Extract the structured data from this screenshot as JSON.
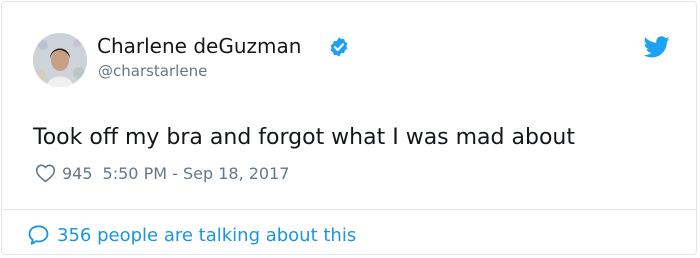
{
  "tweet": {
    "author_name": "Charlene deGuzman",
    "handle": "@charstarlene",
    "text": "Took off my bra and forgot what I was mad about",
    "likes": "945",
    "timestamp": "5:50 PM - Sep 18, 2017",
    "conversation_link": "356 people are talking about this"
  },
  "colors": {
    "twitter_blue": "#1da1f2",
    "link_blue": "#1b95e0",
    "primary_text": "#14171a",
    "secondary_text": "#657786",
    "border": "#e1e8ed"
  },
  "icons": {
    "verified": "verified-badge-icon",
    "brand": "twitter-bird-icon",
    "like": "heart-icon",
    "conversation": "speech-bubble-icon"
  }
}
